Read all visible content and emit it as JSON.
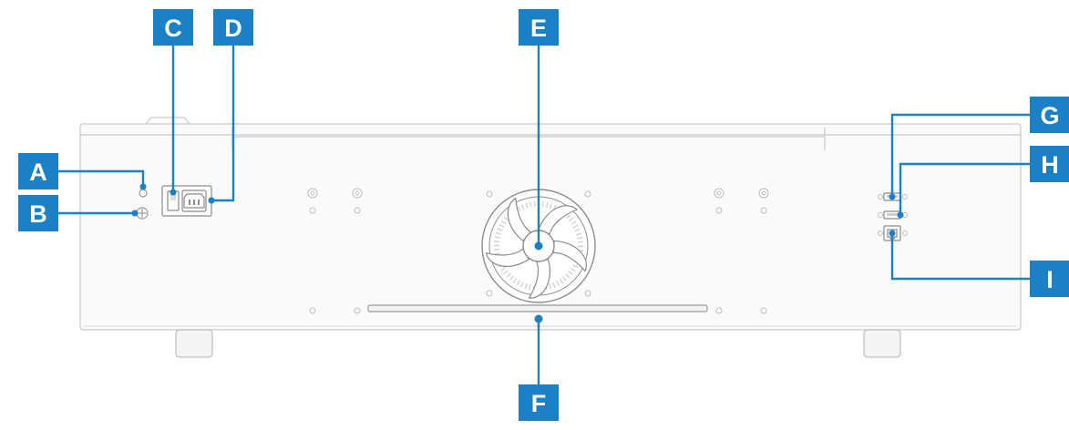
{
  "colors": {
    "callout": "#1b80c4",
    "callout_text": "#ffffff",
    "device_outline": "#c9c9c9",
    "device_fill": "#fafafa"
  },
  "callouts": {
    "a": "A",
    "b": "B",
    "c": "C",
    "d": "D",
    "e": "E",
    "f": "F",
    "g": "G",
    "h": "H",
    "i": "I"
  },
  "icons": {
    "fan": "fan-icon",
    "power_switch": "power-switch-icon",
    "power_socket": "power-socket-icon",
    "usb_port": "usb-port-icon",
    "ethernet_port": "ethernet-port-icon",
    "screw": "screw-icon",
    "foot": "foot-icon"
  }
}
